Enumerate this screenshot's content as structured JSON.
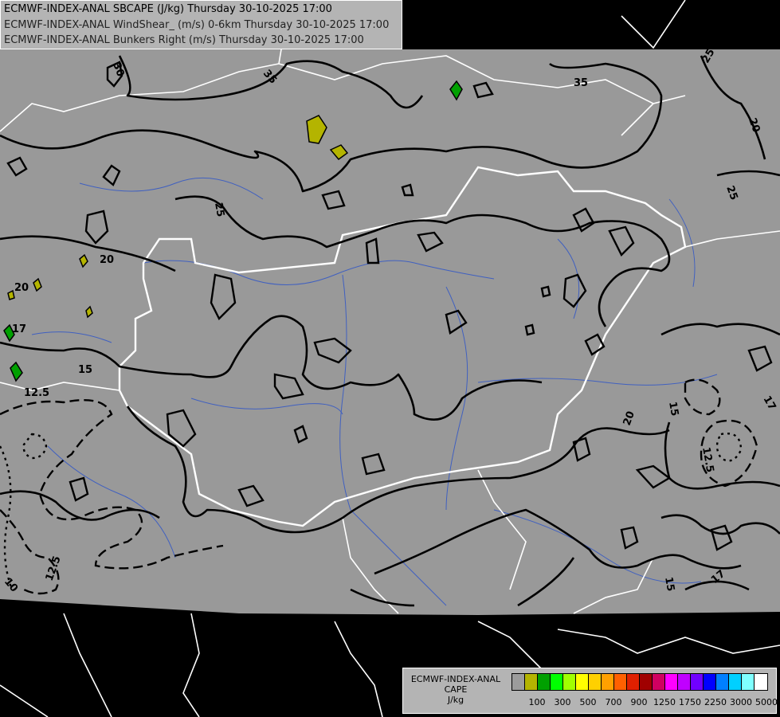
{
  "header": {
    "line1": "ECMWF-INDEX-ANAL SBCAPE (J/kg) Thursday 30-10-2025 17:00",
    "line2": "ECMWF-INDEX-ANAL WindShear_ (m/s) 0-6km Thursday 30-10-2025 17:00",
    "line3": "ECMWF-INDEX-ANAL Bunkers Right (m/s) Thursday 30-10-2025 17:00"
  },
  "legend": {
    "title_line1": "ECMWF-INDEX-ANAL",
    "title_line2": "CAPE",
    "title_line3": "J/kg",
    "colors": [
      "#9c9c9c",
      "#b4b400",
      "#00a000",
      "#00ff00",
      "#a0ff00",
      "#ffff00",
      "#ffd000",
      "#ffa000",
      "#ff6000",
      "#e02000",
      "#a00000",
      "#d00060",
      "#ff00ff",
      "#c000ff",
      "#7000ff",
      "#0000ff",
      "#0080ff",
      "#00d0ff",
      "#80ffff",
      "#ffffff"
    ],
    "tick_labels": [
      "100",
      "300",
      "500",
      "700",
      "900",
      "1250",
      "1750",
      "2250",
      "3000",
      "5000"
    ]
  },
  "map": {
    "colors": {
      "background": "#000000",
      "data_area": "#999999",
      "contours": "#000000",
      "borders": "#ffffff",
      "rivers": "#4060c0",
      "cape_fill": "#b4b400",
      "cape_fill_high": "#00a000"
    },
    "contour_labels": [
      {
        "id": "l30",
        "text": "30"
      },
      {
        "id": "l35a",
        "text": "35"
      },
      {
        "id": "l35b",
        "text": "35"
      },
      {
        "id": "l25a",
        "text": "25"
      },
      {
        "id": "l20a",
        "text": "20"
      },
      {
        "id": "l25b",
        "text": "25"
      },
      {
        "id": "l25c",
        "text": "25"
      },
      {
        "id": "l20b",
        "text": "20"
      },
      {
        "id": "l20c",
        "text": "20"
      },
      {
        "id": "l17a",
        "text": "17"
      },
      {
        "id": "l15a",
        "text": "15"
      },
      {
        "id": "l125a",
        "text": "12.5"
      },
      {
        "id": "l20d",
        "text": "20"
      },
      {
        "id": "l15b",
        "text": "15"
      },
      {
        "id": "l17b",
        "text": "17"
      },
      {
        "id": "l125b",
        "text": "12.5"
      },
      {
        "id": "l125c",
        "text": "12.5"
      },
      {
        "id": "l10",
        "text": "10"
      },
      {
        "id": "l15c",
        "text": "15"
      },
      {
        "id": "l17c",
        "text": "17"
      }
    ]
  }
}
